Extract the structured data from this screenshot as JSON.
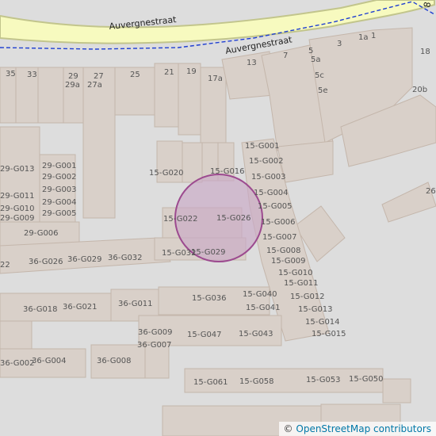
{
  "map": {
    "street_name": "Auvergnestraat",
    "route_label": "Auvergnestraat",
    "edge_label": "8",
    "colors": {
      "background": "#dddddd",
      "building_fill": "#d9d0c9",
      "building_stroke": "#c4b6ab",
      "road_fill": "#f7fabf",
      "road_stroke": "#c2c58c",
      "route_line": "#1f3fd1",
      "marker_fill": "#c9a9c6",
      "marker_stroke": "#9c4a8f"
    },
    "house_numbers": [
      "35",
      "33",
      "29",
      "29a",
      "27",
      "27a",
      "25",
      "21",
      "19",
      "17a",
      "13",
      "7",
      "5",
      "5a",
      "5c",
      "5e",
      "3",
      "1a",
      "1",
      "18",
      "20b",
      "26",
      "29-G013",
      "29-G011",
      "29-G010",
      "29-G009",
      "29-G001",
      "29-G002",
      "29-G003",
      "29-G004",
      "29-G005",
      "29-G006",
      "36-G026",
      "36-G029",
      "36-G032",
      "36-G018",
      "36-G021",
      "36-G011",
      "36-G009",
      "36-G007",
      "36-G004",
      "36-G002",
      "36-G008",
      "22",
      "15-G020",
      "15-G016",
      "15-G022",
      "15-G026",
      "15-G032",
      "15-G029",
      "15-G001",
      "15-G002",
      "15-G003",
      "15-G004",
      "15-G005",
      "15-G006",
      "15-G007",
      "15-G008",
      "15-G009",
      "15-G010",
      "15-G011",
      "15-G012",
      "15-G013",
      "15-G014",
      "15-G015",
      "15-G036",
      "15-G040",
      "15-G041",
      "15-G047",
      "15-G043",
      "15-G061",
      "15-G058",
      "15-G053",
      "15-G050"
    ]
  },
  "attribution": {
    "copyright_symbol": "©",
    "text": "OpenStreetMap contributors"
  }
}
